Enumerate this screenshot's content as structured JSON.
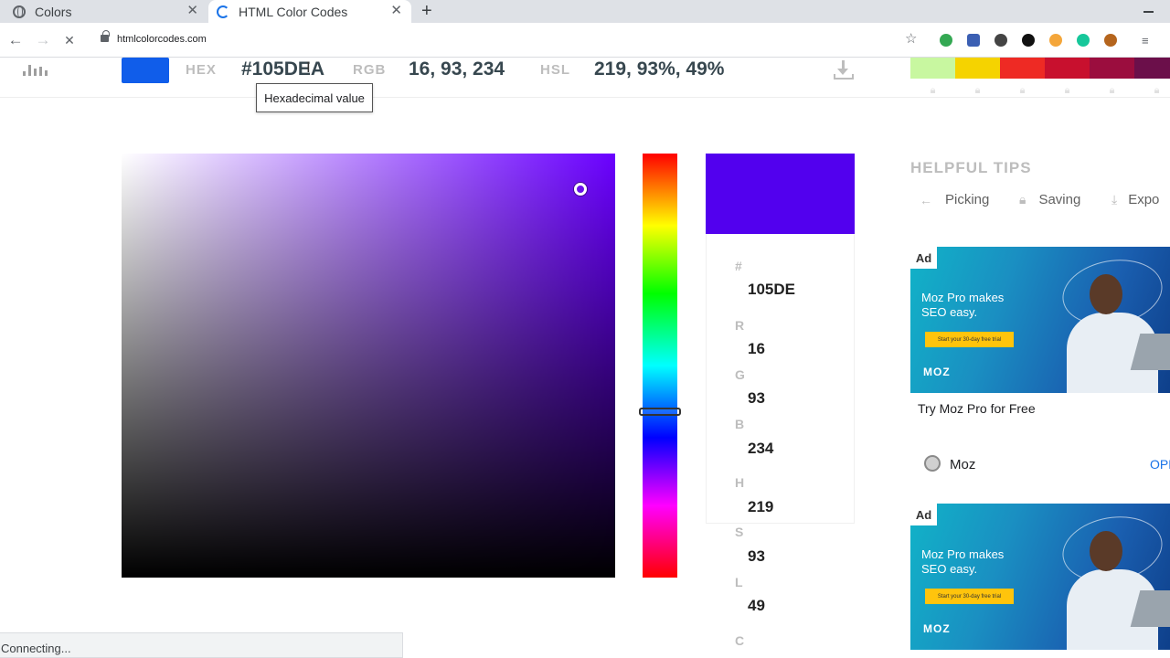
{
  "browser": {
    "tabs": [
      {
        "title": "Colors",
        "state": "inactive"
      },
      {
        "title": "HTML Color Codes",
        "state": "loading"
      }
    ],
    "url": "htmlcolorcodes.com",
    "status": "Connecting..."
  },
  "colorbar": {
    "swatch_color": "#105DEA",
    "hex_label": "HEX",
    "hex_value": "#105DEA",
    "rgb_label": "RGB",
    "rgb_value": "16, 93, 234",
    "hsl_label": "HSL",
    "hsl_value": "219, 93%, 49%",
    "tooltip": "Hexadecimal value",
    "palette": [
      "#c8f7a0",
      "#f5d300",
      "#ee2a24",
      "#c8102e",
      "#9b0d3e",
      "#6b0f4a",
      "#4a0a4a"
    ]
  },
  "picker": {
    "values": [
      {
        "label": "#",
        "value": "105DE"
      },
      {
        "label": "R",
        "value": "16"
      },
      {
        "label": "G",
        "value": "93"
      },
      {
        "label": "B",
        "value": "234"
      },
      {
        "label": "H",
        "value": "219"
      },
      {
        "label": "S",
        "value": "93"
      },
      {
        "label": "L",
        "value": "49"
      },
      {
        "label": "C",
        "value": ""
      }
    ]
  },
  "sidebar": {
    "tips_title": "HELPFUL TIPS",
    "tips": [
      "Picking",
      "Saving",
      "Expo"
    ],
    "ads": [
      {
        "badge": "Ad",
        "headline": "Moz Pro makes SEO easy.",
        "cta": "Start your 30-day free trial",
        "brand": "MOZ"
      },
      {
        "badge": "Ad",
        "headline": "Moz Pro makes SEO easy.",
        "cta": "Start your 30-day free trial",
        "brand": "MOZ"
      }
    ],
    "ad_caption": "Try Moz Pro for Free",
    "advertiser": "Moz",
    "open_label": "OPEN"
  }
}
